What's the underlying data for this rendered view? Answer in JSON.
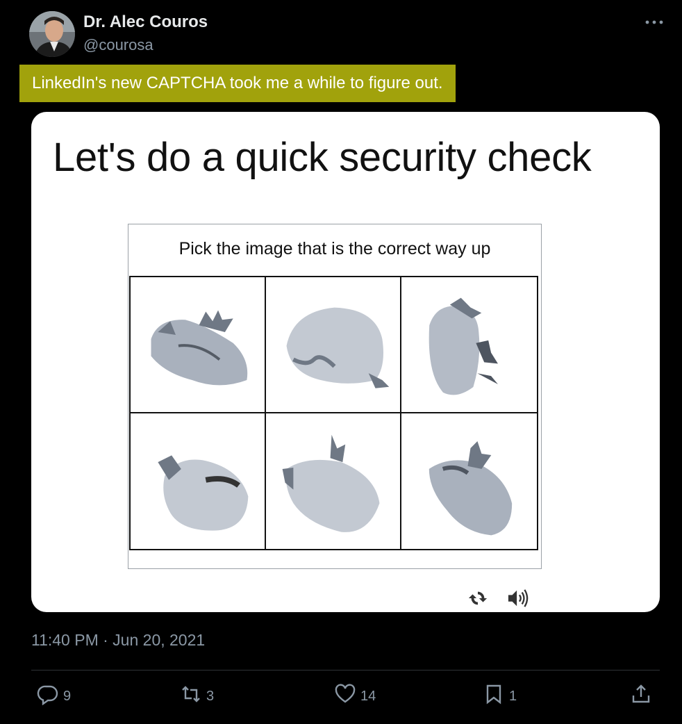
{
  "author": {
    "name": "Dr. Alec Couros",
    "handle": "@courosa"
  },
  "tweet": {
    "text": "LinkedIn's new CAPTCHA took me a while to figure out.",
    "highlight_color": "#a1a20c"
  },
  "media": {
    "title": "Let's do a quick security check",
    "captcha_prompt": "Pick the image that is the correct way up",
    "controls": [
      "refresh-icon",
      "audio-icon"
    ]
  },
  "timestamp": "11:40 PM · Jun 20, 2021",
  "actions": {
    "replies": "9",
    "retweets": "3",
    "likes": "14",
    "bookmarks": "1"
  },
  "icons": [
    "more-icon",
    "reply-icon",
    "retweet-icon",
    "like-icon",
    "bookmark-icon",
    "share-icon"
  ],
  "colors": {
    "background": "#000000",
    "text": "#e7e9ea",
    "muted": "#8b98a5",
    "divider": "#2f3336"
  }
}
